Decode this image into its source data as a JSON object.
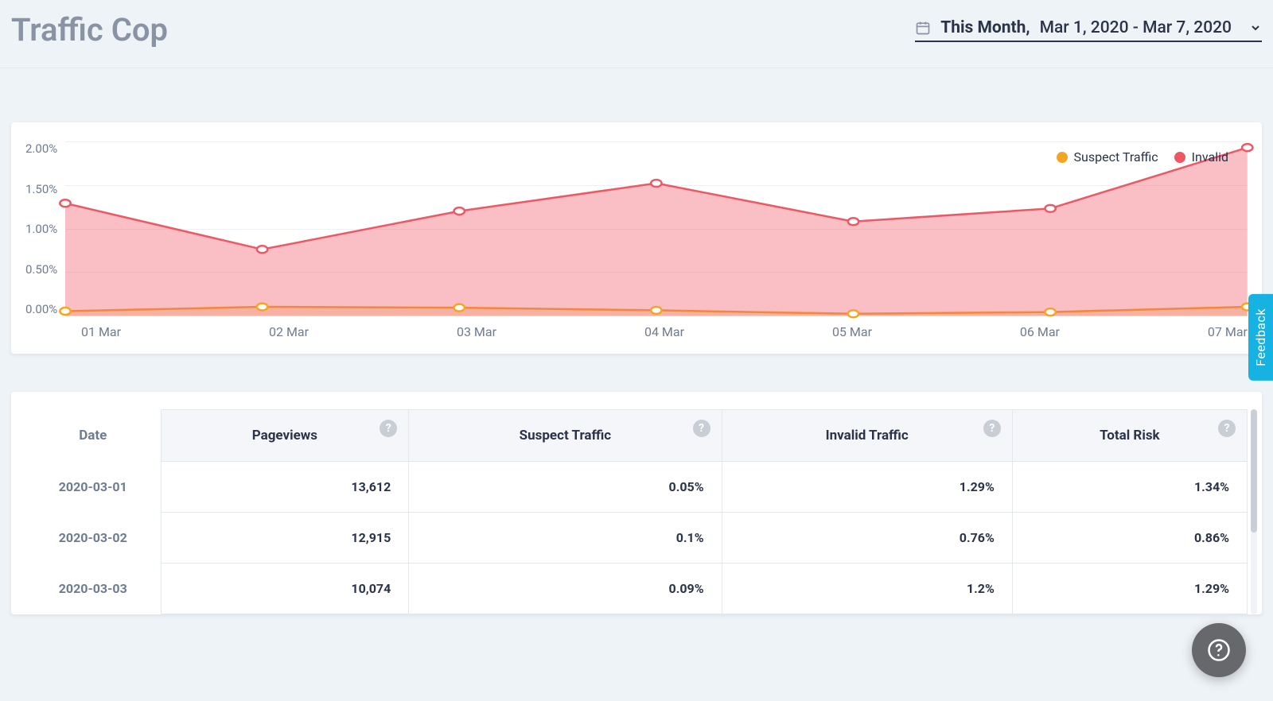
{
  "header": {
    "title": "Traffic Cop",
    "date_label": "This Month,",
    "date_range": "Mar 1, 2020 - Mar 7, 2020"
  },
  "legend": {
    "series_a": "Suspect Traffic",
    "series_b": "Invalid"
  },
  "y_ticks": [
    "2.00%",
    "1.50%",
    "1.00%",
    "0.50%",
    "0.00%"
  ],
  "chart_data": {
    "type": "area",
    "categories": [
      "01 Mar",
      "02 Mar",
      "03 Mar",
      "04 Mar",
      "05 Mar",
      "06 Mar",
      "07 Mar"
    ],
    "series": [
      {
        "name": "Suspect Traffic",
        "color": "#f4a623",
        "values": [
          0.05,
          0.1,
          0.09,
          0.06,
          0.02,
          0.04,
          0.1
        ]
      },
      {
        "name": "Invalid",
        "color": "#ee5864",
        "values": [
          1.29,
          0.76,
          1.2,
          1.52,
          1.08,
          1.23,
          1.93
        ]
      }
    ],
    "ylabel": "",
    "xlabel": "",
    "ylim": [
      0,
      2.0
    ],
    "title": ""
  },
  "table": {
    "headers": {
      "date": "Date",
      "pageviews": "Pageviews",
      "suspect": "Suspect Traffic",
      "invalid": "Invalid Traffic",
      "risk": "Total Risk"
    },
    "rows": [
      {
        "date": "2020-03-01",
        "pageviews": "13,612",
        "suspect": "0.05%",
        "invalid": "1.29%",
        "risk": "1.34%"
      },
      {
        "date": "2020-03-02",
        "pageviews": "12,915",
        "suspect": "0.1%",
        "invalid": "0.76%",
        "risk": "0.86%"
      },
      {
        "date": "2020-03-03",
        "pageviews": "10,074",
        "suspect": "0.09%",
        "invalid": "1.2%",
        "risk": "1.29%"
      }
    ]
  },
  "feedback_label": "Feedback"
}
